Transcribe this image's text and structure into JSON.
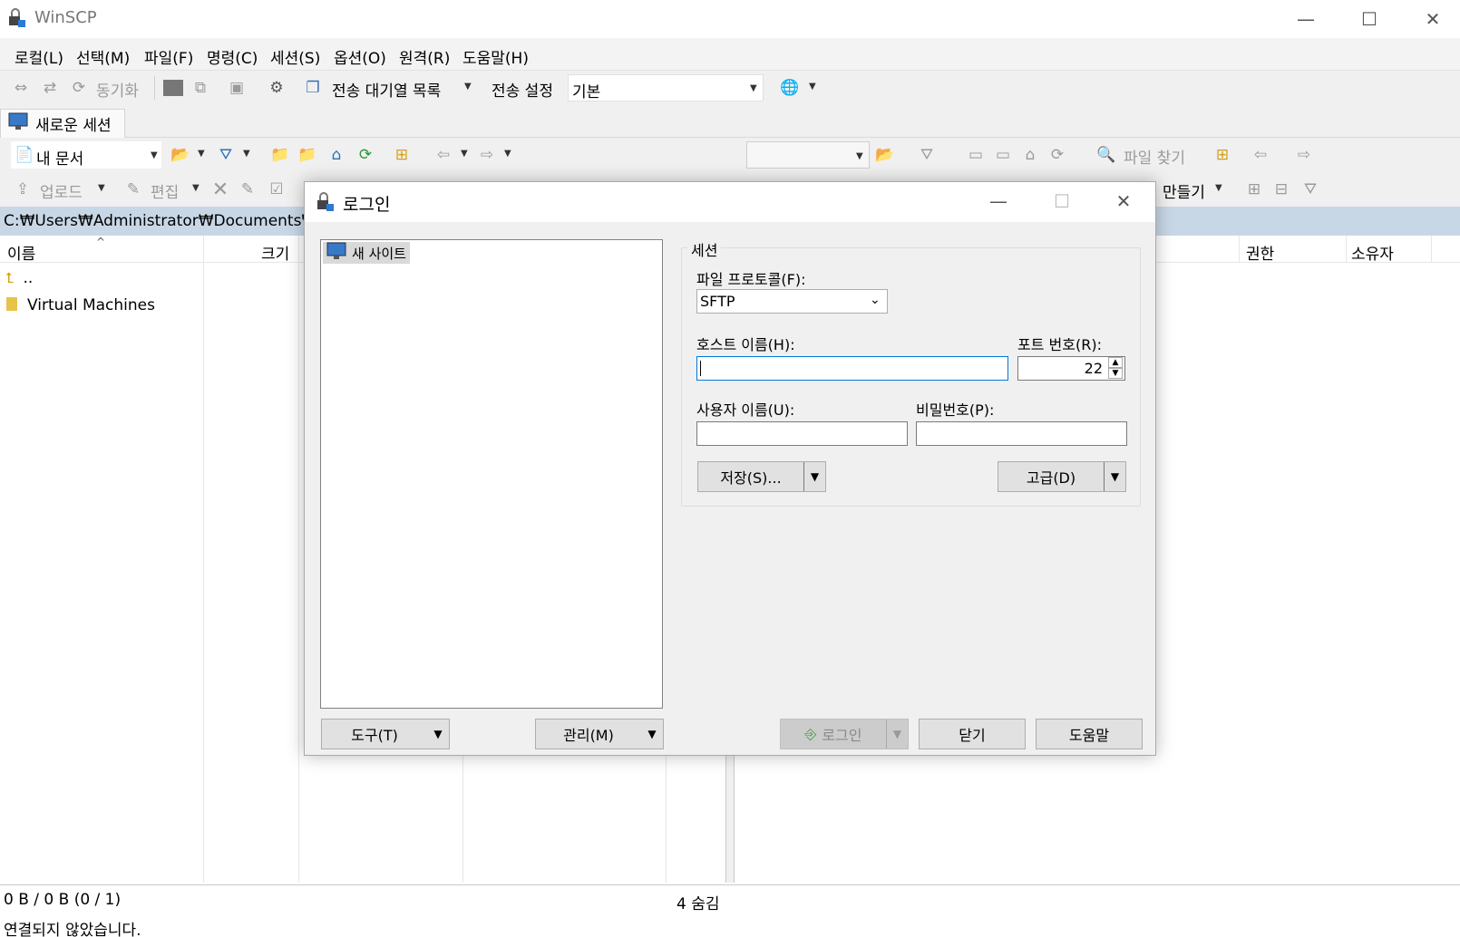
{
  "app": {
    "title": "WinSCP"
  },
  "menu": [
    "로컬(L)",
    "선택(M)",
    "파일(F)",
    "명령(C)",
    "세션(S)",
    "옵션(O)",
    "원격(R)",
    "도움말(H)"
  ],
  "toolbar": {
    "sync_label": "동기화",
    "queue_label": "전송 대기열 목록",
    "transfer_settings_label": "전송 설정",
    "transfer_settings_value": "기본"
  },
  "tabs": {
    "new_session": "새로운 세션"
  },
  "local": {
    "location": "내 문서",
    "upload_label": "업로드",
    "edit_label": "편집",
    "path": "C:₩Users₩Administrator₩Documents₩",
    "columns": {
      "name": "이름",
      "size": "크기"
    },
    "files": [
      {
        "name": ".."
      },
      {
        "name": "Virtual Machines"
      }
    ],
    "status_size": "0 B / 0 B (0 / 1)",
    "hidden_count": "4 숨김"
  },
  "remote": {
    "find_files_label": "파일 찾기",
    "new_label": "만들기",
    "columns": {
      "permissions": "권한",
      "owner": "소유자"
    }
  },
  "status": {
    "connection": "연결되지 않았습니다."
  },
  "login_dialog": {
    "title": "로그인",
    "site_tree": {
      "new_site": "새 사이트"
    },
    "session_group": "세션",
    "protocol_label": "파일 프로토콜(F):",
    "protocol_value": "SFTP",
    "host_label": "호스트 이름(H):",
    "host_value": "",
    "port_label": "포트 번호(R):",
    "port_value": "22",
    "user_label": "사용자 이름(U):",
    "user_value": "",
    "password_label": "비밀번호(P):",
    "password_value": "",
    "save_button": "저장(S)...",
    "advanced_button": "고급(D)",
    "tools_button": "도구(T)",
    "manage_button": "관리(M)",
    "login_button": "로그인",
    "close_button": "닫기",
    "help_button": "도움말"
  }
}
